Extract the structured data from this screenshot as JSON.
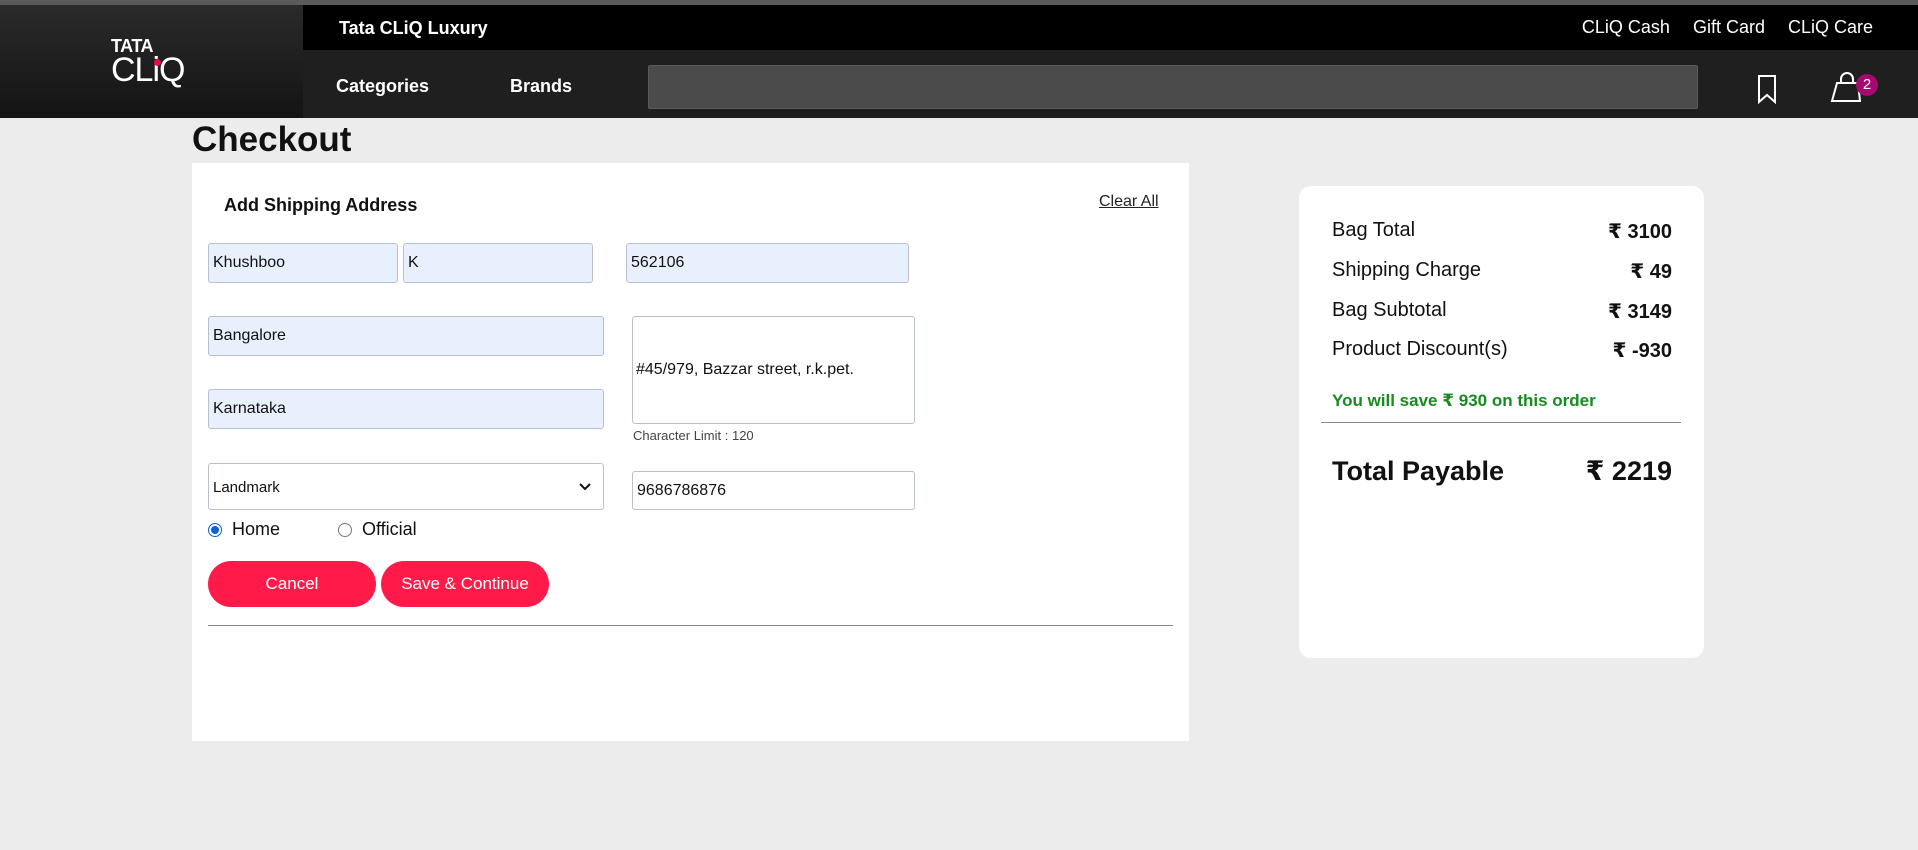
{
  "header": {
    "logo_top": "TATA",
    "logo_bottom": "CLiQ",
    "luxury": "Tata CLiQ Luxury",
    "top_links": [
      "CLiQ Cash",
      "Gift Card",
      "CLiQ Care"
    ],
    "nav": {
      "categories": "Categories",
      "brands": "Brands"
    },
    "search_placeholder": "",
    "bag_count": "2"
  },
  "checkout": {
    "title": "Checkout",
    "form_heading": "Add Shipping Address",
    "clear_all": "Clear All",
    "fields": {
      "first_name": "Khushboo",
      "last_name": "K",
      "pincode": "562106",
      "city": "Bangalore",
      "state": "Karnataka",
      "address": "#45/979, Bazzar street, r.k.pet.",
      "phone": "9686786876"
    },
    "char_limit": "Character Limit : 120",
    "landmark_selected": "Landmark",
    "address_type": {
      "home": "Home",
      "official": "Official",
      "selected": "home"
    },
    "cancel_label": "Cancel",
    "save_label": "Save & Continue"
  },
  "summary": {
    "rows": [
      {
        "label": "Bag Total",
        "value": "₹ 3100"
      },
      {
        "label": "Shipping Charge",
        "value": "₹ 49"
      },
      {
        "label": "Bag Subtotal",
        "value": "₹ 3149"
      },
      {
        "label": "Product Discount(s)",
        "value": "₹ -930"
      }
    ],
    "save_message": "You will save ₹ 930 on this order",
    "total_label": "Total Payable",
    "total_value": "₹ 2219"
  },
  "colors": {
    "accent": "#ff1a4a",
    "save_green": "#168b1f",
    "badge": "#a6096f"
  }
}
